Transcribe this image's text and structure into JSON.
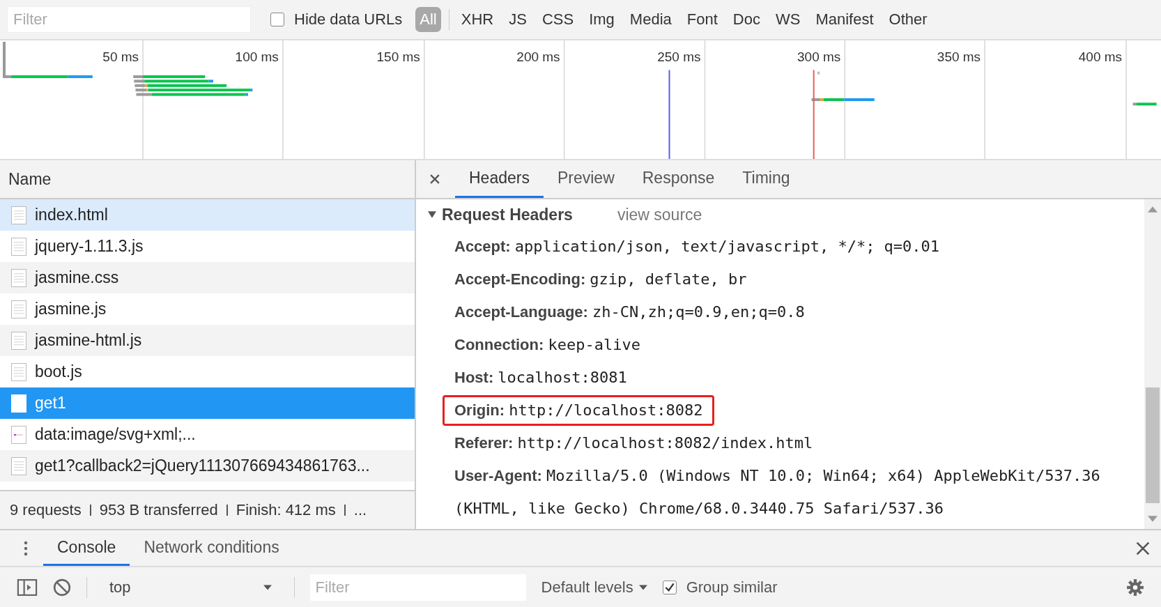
{
  "filter_bar": {
    "placeholder": "Filter",
    "hide_data_urls": {
      "label": "Hide data URLs",
      "checked": false
    },
    "types": [
      {
        "label": "All",
        "selected": true
      },
      {
        "label": "XHR",
        "selected": false
      },
      {
        "label": "JS",
        "selected": false
      },
      {
        "label": "CSS",
        "selected": false
      },
      {
        "label": "Img",
        "selected": false
      },
      {
        "label": "Media",
        "selected": false
      },
      {
        "label": "Font",
        "selected": false
      },
      {
        "label": "Doc",
        "selected": false
      },
      {
        "label": "WS",
        "selected": false
      },
      {
        "label": "Manifest",
        "selected": false
      },
      {
        "label": "Other",
        "selected": false
      }
    ]
  },
  "timeline": {
    "ticks": [
      "50 ms",
      "100 ms",
      "150 ms",
      "200 ms",
      "250 ms",
      "300 ms",
      "350 ms",
      "400 ms"
    ]
  },
  "requests": {
    "column": "Name",
    "rows": [
      {
        "name": "index.html",
        "kind": "document",
        "selected": false,
        "hovered": true
      },
      {
        "name": "jquery-1.11.3.js",
        "kind": "document",
        "selected": false,
        "hovered": false
      },
      {
        "name": "jasmine.css",
        "kind": "document",
        "selected": false,
        "hovered": false
      },
      {
        "name": "jasmine.js",
        "kind": "document",
        "selected": false,
        "hovered": false
      },
      {
        "name": "jasmine-html.js",
        "kind": "document",
        "selected": false,
        "hovered": false
      },
      {
        "name": "boot.js",
        "kind": "document",
        "selected": false,
        "hovered": false
      },
      {
        "name": "get1",
        "kind": "document",
        "selected": true,
        "hovered": false
      },
      {
        "name": "data:image/svg+xml;...",
        "kind": "image",
        "selected": false,
        "hovered": false
      },
      {
        "name": "get1?callback2=jQuery111307669434861763...",
        "kind": "document",
        "selected": false,
        "hovered": false
      }
    ]
  },
  "status_bar": [
    "9 requests",
    "953 B transferred",
    "Finish: 412 ms",
    "..."
  ],
  "details": {
    "tabs": [
      {
        "label": "Headers",
        "selected": true
      },
      {
        "label": "Preview",
        "selected": false
      },
      {
        "label": "Response",
        "selected": false
      },
      {
        "label": "Timing",
        "selected": false
      }
    ],
    "section": {
      "title": "Request Headers",
      "expanded": true,
      "view_source": "view source",
      "headers": [
        {
          "name": "Accept:",
          "value": "application/json, text/javascript, */*; q=0.01",
          "highlighted": false
        },
        {
          "name": "Accept-Encoding:",
          "value": "gzip, deflate, br",
          "highlighted": false
        },
        {
          "name": "Accept-Language:",
          "value": "zh-CN,zh;q=0.9,en;q=0.8",
          "highlighted": false
        },
        {
          "name": "Connection:",
          "value": "keep-alive",
          "highlighted": false
        },
        {
          "name": "Host:",
          "value": "localhost:8081",
          "highlighted": false
        },
        {
          "name": "Origin:",
          "value": "http://localhost:8082",
          "highlighted": true
        },
        {
          "name": "Referer:",
          "value": "http://localhost:8082/index.html",
          "highlighted": false
        },
        {
          "name": "User-Agent:",
          "value": "Mozilla/5.0 (Windows NT 10.0; Win64; x64) AppleWebKit/537.36 (KHTML, like Gecko) Chrome/68.0.3440.75 Safari/537.36",
          "highlighted": false
        }
      ]
    }
  },
  "drawer": {
    "tabs": [
      {
        "label": "Console",
        "selected": true
      },
      {
        "label": "Network conditions",
        "selected": false
      }
    ]
  },
  "console_toolbar": {
    "context": "top",
    "filter_placeholder": "Filter",
    "levels": "Default levels",
    "group_similar": {
      "label": "Group similar",
      "checked": true
    }
  }
}
